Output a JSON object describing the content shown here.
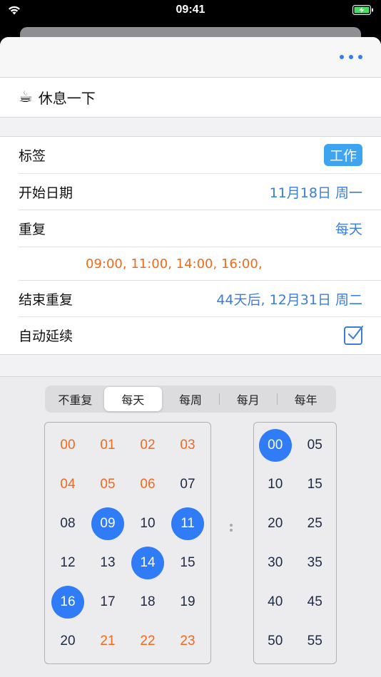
{
  "status_bar": {
    "time": "09:41"
  },
  "header": {
    "more_label": "more"
  },
  "task": {
    "icon": "☕",
    "title": "休息一下"
  },
  "settings": {
    "tag": {
      "label": "标签",
      "value": "工作"
    },
    "start_date": {
      "label": "开始日期",
      "value": "11月18日 周一"
    },
    "repeat": {
      "label": "重复",
      "value": "每天"
    },
    "times": "09:00, 11:00, 14:00, 16:00,",
    "end_repeat": {
      "label": "结束重复",
      "value": "44天后, 12月31日 周二"
    },
    "auto_extend": {
      "label": "自动延续",
      "checked": true
    }
  },
  "segments": [
    "不重复",
    "每天",
    "每周",
    "每月",
    "每年"
  ],
  "active_segment": "每天",
  "hours": [
    {
      "v": "00",
      "s": "orange"
    },
    {
      "v": "01",
      "s": "orange"
    },
    {
      "v": "02",
      "s": "orange"
    },
    {
      "v": "03",
      "s": "orange"
    },
    {
      "v": "04",
      "s": "orange"
    },
    {
      "v": "05",
      "s": "orange"
    },
    {
      "v": "06",
      "s": "orange"
    },
    {
      "v": "07",
      "s": "dark"
    },
    {
      "v": "08",
      "s": "dark"
    },
    {
      "v": "09",
      "s": "selected"
    },
    {
      "v": "10",
      "s": "dark"
    },
    {
      "v": "11",
      "s": "selected"
    },
    {
      "v": "12",
      "s": "dark"
    },
    {
      "v": "13",
      "s": "dark"
    },
    {
      "v": "14",
      "s": "selected"
    },
    {
      "v": "15",
      "s": "dark"
    },
    {
      "v": "16",
      "s": "selected"
    },
    {
      "v": "17",
      "s": "dark"
    },
    {
      "v": "18",
      "s": "dark"
    },
    {
      "v": "19",
      "s": "dark"
    },
    {
      "v": "20",
      "s": "dark"
    },
    {
      "v": "21",
      "s": "orange"
    },
    {
      "v": "22",
      "s": "orange"
    },
    {
      "v": "23",
      "s": "orange"
    }
  ],
  "minutes": [
    {
      "v": "00",
      "s": "selected"
    },
    {
      "v": "05",
      "s": "dark"
    },
    {
      "v": "10",
      "s": "dark"
    },
    {
      "v": "15",
      "s": "dark"
    },
    {
      "v": "20",
      "s": "dark"
    },
    {
      "v": "25",
      "s": "dark"
    },
    {
      "v": "30",
      "s": "dark"
    },
    {
      "v": "35",
      "s": "dark"
    },
    {
      "v": "40",
      "s": "dark"
    },
    {
      "v": "45",
      "s": "dark"
    },
    {
      "v": "50",
      "s": "dark"
    },
    {
      "v": "55",
      "s": "dark"
    }
  ],
  "colors": {
    "accent": "#2f7cf6",
    "orange": "#ef6a1e",
    "link": "#3b7dd8",
    "tag": "#3fa4f0"
  },
  "icons": [
    "wifi-icon",
    "battery-charging-icon",
    "more-icon",
    "coffee-icon",
    "checkbox-checked-icon"
  ]
}
